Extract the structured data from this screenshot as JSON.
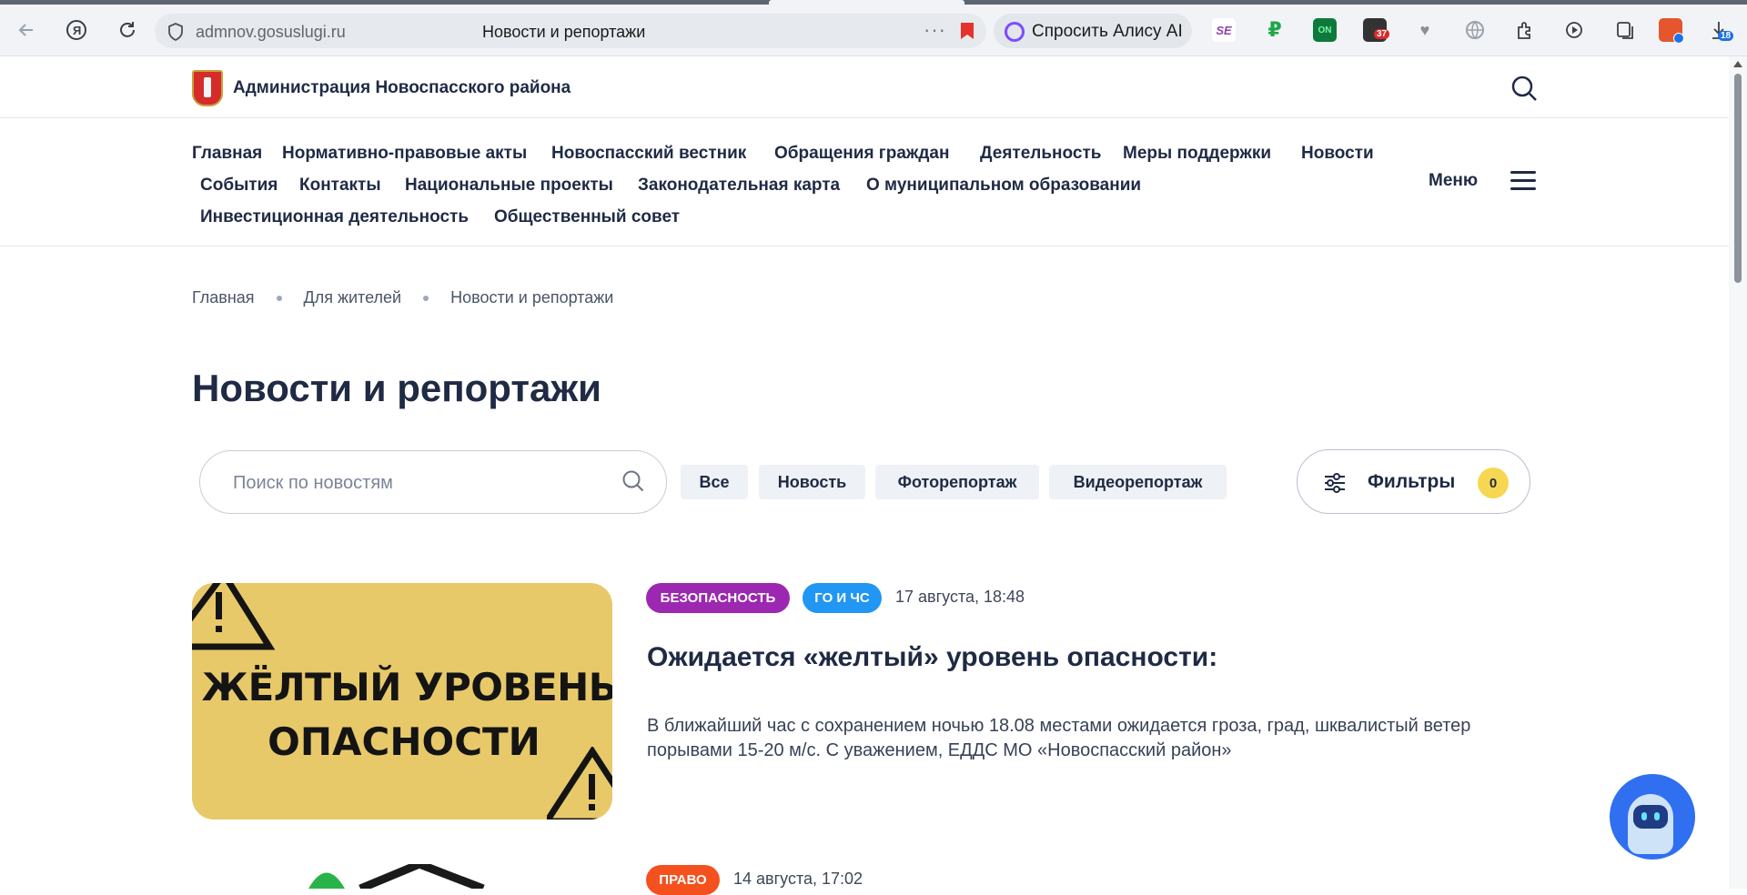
{
  "browser": {
    "url": "admnov.gosuslugi.ru",
    "page_title": "Новости и репортажи",
    "alice_label": "Спросить Алису AI",
    "badges": {
      "mail_count": "37",
      "downloads_count": "18"
    },
    "icons": [
      "back-icon",
      "yandex-icon",
      "reload-icon",
      "shield-icon",
      "more-icon",
      "bookmark-icon"
    ]
  },
  "site": {
    "name": "Администрация Новоспасского района"
  },
  "nav": {
    "items": [
      "Главная",
      "Нормативно-правовые акты",
      "Новоспасский вестник",
      "Обращения граждан",
      "Деятельность",
      "Меры поддержки",
      "Новости",
      "События",
      "Контакты",
      "Национальные проекты",
      "Законодательная карта",
      "О муниципальном образовании",
      "Инвестиционная деятельность",
      "Общественный совет"
    ],
    "menu_label": "Меню"
  },
  "breadcrumb": [
    "Главная",
    "Для жителей",
    "Новости и репортажи"
  ],
  "page": {
    "title": "Новости и репортажи"
  },
  "search": {
    "placeholder": "Поиск по новостям",
    "value": ""
  },
  "chips": [
    "Все",
    "Новость",
    "Фоторепортаж",
    "Видеорепортаж"
  ],
  "filters": {
    "label": "Фильтры",
    "count": "0"
  },
  "news": [
    {
      "tags": [
        {
          "label": "БЕЗОПАСНОСТЬ",
          "color": "#9c27b0"
        },
        {
          "label": "ГО И ЧС",
          "color": "#2196f3"
        }
      ],
      "date": "17 августа, 18:48",
      "title": "Ожидается «желтый» уровень опасности:",
      "text": "В ближайший час с сохранением ночью 18.08 местами ожидается гроза, град, шквалистый ветер порывами 15-20 м/с. С уважением, ЕДДС МО «Новоспасский район»",
      "image_text": {
        "line1": "ЖЁЛТЫЙ УРОВЕНЬ",
        "line2": "ОПАСНОСТИ"
      },
      "image_color": "#e8c96a"
    },
    {
      "tags": [
        {
          "label": "ПРАВО",
          "color": "#f4511e"
        }
      ],
      "date": "14 августа, 17:02"
    }
  ],
  "colors": {
    "accent_dark": "#1f2a44",
    "chip_bg": "#eef1f5",
    "filter_badge": "#f7d752",
    "bot": "#2f6ff0"
  }
}
